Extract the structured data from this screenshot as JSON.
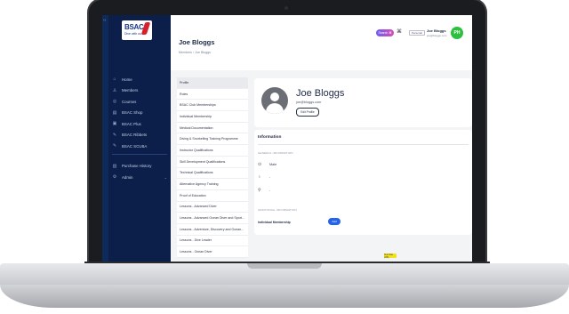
{
  "app": {
    "logo_text": "BSAC",
    "logo_sub": "Dive with us",
    "accent": "#0b1f4a",
    "brand_red": "#d6202a"
  },
  "nav": {
    "items": [
      {
        "label": "Home",
        "icon": "home-icon",
        "glyph": "⌂"
      },
      {
        "label": "Members",
        "icon": "user-icon",
        "glyph": "♙"
      },
      {
        "label": "Courses",
        "icon": "book-icon",
        "glyph": "◎"
      },
      {
        "label": "BSAC Shop",
        "icon": "shop-icon",
        "glyph": "▤"
      },
      {
        "label": "BSAC Plus",
        "icon": "plus-icon",
        "glyph": "▣"
      },
      {
        "label": "BSAC Ribbets",
        "icon": "tag-icon",
        "glyph": "✎"
      },
      {
        "label": "BSAC SCUBA",
        "icon": "scuba-icon",
        "glyph": "✎"
      }
    ],
    "secondary": [
      {
        "label": "Purchase History",
        "icon": "history-icon",
        "glyph": "▥"
      },
      {
        "label": "Admin",
        "icon": "gear-icon",
        "glyph": "⚙"
      }
    ]
  },
  "header": {
    "title": "Joe Bloggs",
    "breadcrumb": "Members  ›  Joe Bloggs",
    "search_label": "Search ⌘",
    "close_glyph": "⌘",
    "role_chip": "Personal",
    "user_name": "Joe Bloggs",
    "user_email": "joe@bloggs.com",
    "avatar_initials": "PH"
  },
  "menu": {
    "items": [
      "Profile",
      "Roles",
      "BSAC Club Memberships",
      "Individual Membership",
      "Medical Documentation",
      "Diving & Snorkelling Training Programme",
      "Instructor Qualifications",
      "Skill Development Qualifications",
      "Technical Qualifications",
      "Alternative Agency Training",
      "Proof of Education",
      "Lessons - Advanced Diver",
      "Lessons - Advanced Ocean Diver and Sport...",
      "Lessons - Adventure, Discovery and Ocean...",
      "Lessons - Dive Leader",
      "Lessons - Ocean Diver"
    ],
    "active_index": 0
  },
  "profile": {
    "name": "Joe Bloggs",
    "email": "joe@bloggs.com",
    "edit_label": "Edit Profile"
  },
  "info": {
    "title": "Information",
    "general_label": "GENERAL INFORMATION",
    "rows": [
      {
        "icon": "gender-icon",
        "glyph": "⊙",
        "value": "Male"
      },
      {
        "icon": "cake-icon",
        "glyph": "♁",
        "value": "-"
      },
      {
        "icon": "location-icon",
        "glyph": "⚲",
        "value": "-"
      }
    ],
    "additional_label": "ADDITIONAL INFORMATION",
    "membership_label": "Individual Membership",
    "add_label": "Add"
  },
  "badge": {
    "label": "Test Site (UK)"
  }
}
